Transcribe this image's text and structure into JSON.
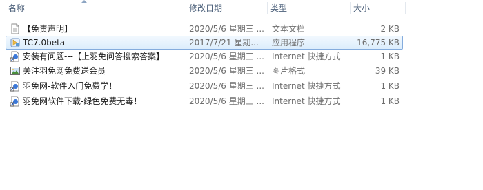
{
  "columns": {
    "name": "名称",
    "date": "修改日期",
    "type": "类型",
    "size": "大小"
  },
  "files": [
    {
      "name": "【免责声明】",
      "date": "2020/5/6 星期三 ...",
      "type": "文本文档",
      "size": "2 KB",
      "icon": "text-document-icon",
      "selected": false
    },
    {
      "name": "TC7.0beta",
      "date": "2017/7/21 星期...",
      "type": "应用程序",
      "size": "16,775 KB",
      "icon": "application-icon",
      "selected": true
    },
    {
      "name": "安装有问题---【上羽免问答搜索答案】",
      "date": "2020/5/6 星期三 ...",
      "type": "Internet 快捷方式",
      "size": "1 KB",
      "icon": "internet-shortcut-icon",
      "selected": false
    },
    {
      "name": "关注羽免网免费送会员",
      "date": "2020/5/6 星期三 ...",
      "type": "图片格式",
      "size": "39 KB",
      "icon": "image-file-icon",
      "selected": false
    },
    {
      "name": "羽免网-软件入门免费学！",
      "date": "2020/5/6 星期三 ...",
      "type": "Internet 快捷方式",
      "size": "1 KB",
      "icon": "internet-shortcut-icon",
      "selected": false
    },
    {
      "name": "羽免网软件下载-绿色免费无毒！",
      "date": "2020/5/6 星期三 ...",
      "type": "Internet 快捷方式",
      "size": "1 KB",
      "icon": "internet-shortcut-icon",
      "selected": false
    }
  ]
}
